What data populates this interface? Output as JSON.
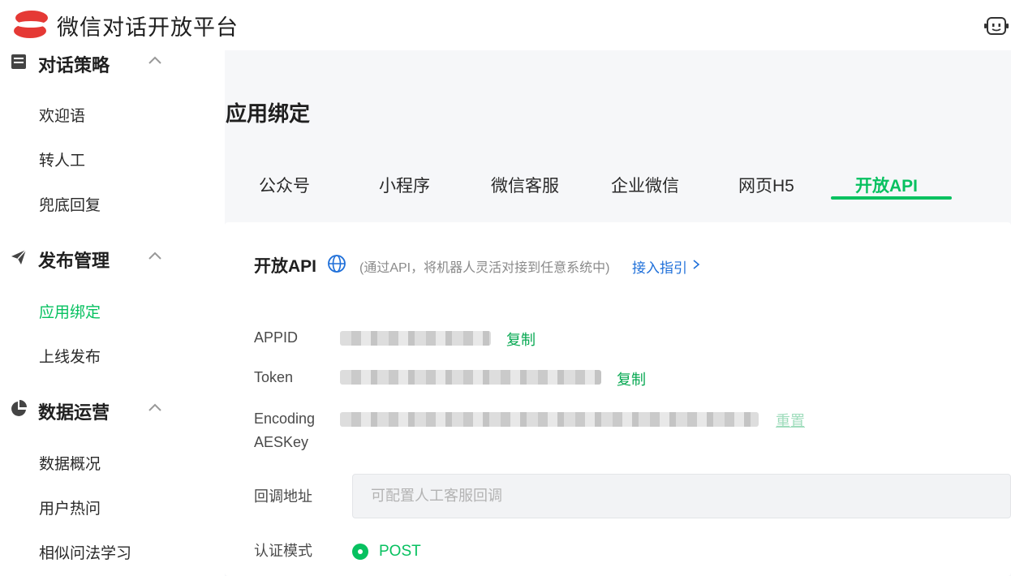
{
  "header": {
    "app_title": "微信对话开放平台",
    "brand_color": "#e53935",
    "right_icon": "robot-face-icon"
  },
  "sidebar": {
    "partial_group": {
      "label": "对话策略",
      "icon": "strategy-icon"
    },
    "items_top": [
      "欢迎语",
      "转人工",
      "兜底回复"
    ],
    "publish_group": {
      "label": "发布管理",
      "icon": "paper-plane-icon"
    },
    "publish_items": [
      "应用绑定",
      "上线发布"
    ],
    "data_group": {
      "label": "数据运营",
      "icon": "pie-chart-icon"
    },
    "data_items": [
      "数据概况",
      "用户热问",
      "相似问法学习"
    ]
  },
  "main": {
    "page_title": "应用绑定",
    "tabs": [
      "公众号",
      "小程序",
      "微信客服",
      "企业微信",
      "网页H5",
      "开放API"
    ],
    "active_tab": "开放API",
    "accent_color": "#07c160",
    "section": {
      "title": "开放API",
      "desc": "(通过API，将机器人灵活对接到任意系统中)",
      "guide_link": "接入指引"
    },
    "fields": {
      "appid_label": "APPID",
      "token_label": "Token",
      "aeskey_label_1": "Encoding",
      "aeskey_label_2": "AESKey",
      "copy": "复制",
      "reset": "重置",
      "callback_label": "回调地址",
      "callback_placeholder": "可配置人工客服回调",
      "auth_label": "认证模式",
      "auth_value": "POST"
    }
  }
}
